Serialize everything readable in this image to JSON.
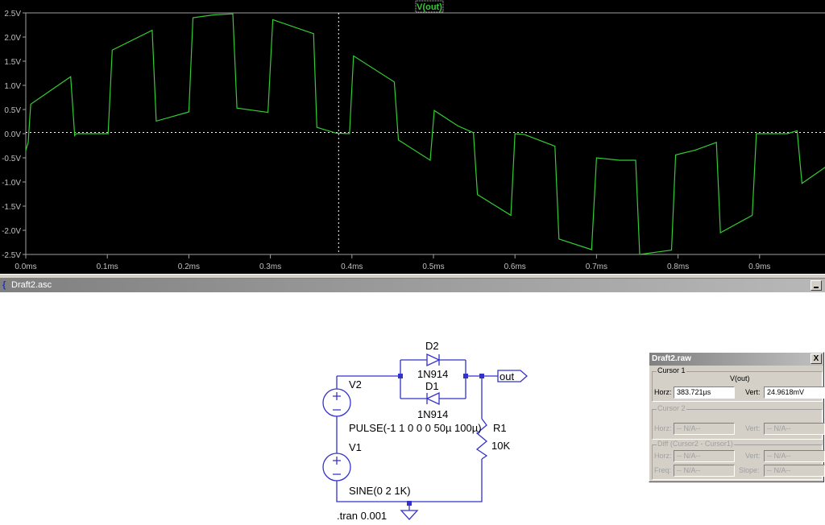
{
  "plot": {
    "trace_label": "V(out)",
    "colors": {
      "trace": "#33cc33",
      "background": "#000000",
      "axis": "#a0a0a0",
      "cursor": "#ffffff"
    },
    "cursor": {
      "time_ms": 0.3837,
      "value_v": 0.025
    }
  },
  "chart_data": {
    "type": "line",
    "xlabel": "",
    "ylabel": "",
    "xlim": [
      0,
      1.0
    ],
    "ylim": [
      -2.5,
      2.5
    ],
    "x_ticks": [
      0,
      0.1,
      0.2,
      0.3,
      0.4,
      0.5,
      0.6,
      0.7,
      0.8,
      0.9,
      1.0
    ],
    "x_tick_labels": [
      "0.0ms",
      "0.1ms",
      "0.2ms",
      "0.3ms",
      "0.4ms",
      "0.5ms",
      "0.6ms",
      "0.7ms",
      "0.8ms",
      "0.9ms",
      "1.0ms"
    ],
    "y_ticks": [
      2.5,
      2.0,
      1.5,
      1.0,
      0.5,
      0.0,
      -0.5,
      -1.0,
      -1.5,
      -2.0,
      -2.5
    ],
    "y_tick_labels": [
      "2.5V",
      "2.0V",
      "1.5V",
      "1.0V",
      "0.5V",
      "0.0V",
      "-0.5V",
      "-1.0V",
      "-1.5V",
      "-2.0V",
      "-2.5V"
    ],
    "series": [
      {
        "name": "V(out)",
        "x": [
          0,
          0.003,
          0.006,
          0.055,
          0.06,
          0.062,
          0.101,
          0.106,
          0.155,
          0.16,
          0.2,
          0.205,
          0.231,
          0.254,
          0.259,
          0.297,
          0.303,
          0.353,
          0.357,
          0.381,
          0.397,
          0.402,
          0.452,
          0.457,
          0.496,
          0.501,
          0.53,
          0.549,
          0.554,
          0.595,
          0.6,
          0.612,
          0.649,
          0.654,
          0.694,
          0.7,
          0.728,
          0.748,
          0.753,
          0.792,
          0.797,
          0.821,
          0.847,
          0.852,
          0.891,
          0.896,
          0.934,
          0.946,
          0.952,
          0.98,
          1.0
        ],
        "y": [
          -0.35,
          -0.18,
          0.61,
          1.18,
          -0.04,
          0.0,
          0.0,
          1.73,
          2.14,
          0.26,
          0.45,
          2.4,
          2.46,
          2.48,
          0.53,
          0.44,
          2.36,
          2.07,
          0.13,
          0.01,
          0.0,
          1.61,
          1.07,
          -0.13,
          -0.55,
          0.48,
          0.16,
          0.02,
          -1.26,
          -1.69,
          0.0,
          -0.02,
          -0.26,
          -2.18,
          -2.4,
          -0.5,
          -0.55,
          -0.55,
          -2.5,
          -2.41,
          -0.44,
          -0.34,
          -0.18,
          -2.05,
          -1.69,
          0.0,
          0.0,
          0.06,
          -1.03,
          -0.7,
          -0.55
        ]
      }
    ]
  },
  "schematic": {
    "window_title": "Draft2.asc",
    "d2_name": "D2",
    "d2_model": "1N914",
    "d1_name": "D1",
    "d1_model": "1N914",
    "v2_name": "V2",
    "v2_value": "PULSE(-1 1 0 0 0 50µ 100µ)",
    "r1_name": "R1",
    "r1_value": "10K",
    "v1_name": "V1",
    "v1_value": "SINE(0 2 1K)",
    "net_label": "out",
    "directive": ".tran 0.001",
    "colors": {
      "wire": "#3333cc"
    }
  },
  "cursor_dialog": {
    "title": "Draft2.raw",
    "close": "X",
    "cursor1": {
      "label": "Cursor 1",
      "trace": "V(out)",
      "horz_label": "Horz:",
      "horz": "383.721µs",
      "vert_label": "Vert:",
      "vert": "24.9618mV"
    },
    "cursor2": {
      "label": "Cursor 2",
      "horz_label": "Horz:",
      "horz": "-- N/A--",
      "vert_label": "Vert:",
      "vert": "-- N/A--"
    },
    "diff": {
      "label": "Diff (Cursor2 - Cursor1)",
      "horz_label": "Horz:",
      "horz": "-- N/A--",
      "vert_label": "Vert:",
      "vert": "-- N/A--",
      "freq_label": "Freq:",
      "freq": "-- N/A--",
      "slope_label": "Slope:",
      "slope": "-- N/A--"
    }
  }
}
